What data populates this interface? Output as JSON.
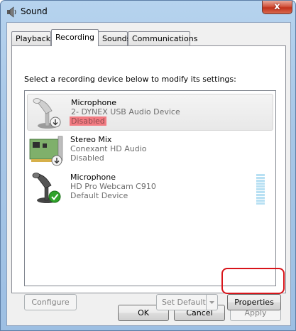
{
  "window": {
    "title": "Sound",
    "close_glyph": "x"
  },
  "tabs": [
    {
      "label": "Playback",
      "active": false
    },
    {
      "label": "Recording",
      "active": true
    },
    {
      "label": "Sounds",
      "active": false
    },
    {
      "label": "Communications",
      "active": false
    }
  ],
  "instruction": "Select a recording device below to modify its settings:",
  "devices": [
    {
      "name": "Microphone",
      "description": "2- DYNEX USB Audio Device",
      "status": "Disabled",
      "icon": "microphone-disabled-icon",
      "selected": true
    },
    {
      "name": "Stereo Mix",
      "description": "Conexant HD Audio",
      "status": "Disabled",
      "icon": "sound-card-disabled-icon",
      "selected": false
    },
    {
      "name": "Microphone",
      "description": "HD Pro Webcam C910",
      "status": "Default Device",
      "icon": "microphone-default-icon",
      "selected": false
    }
  ],
  "buttons": {
    "configure": "Configure",
    "set_default": "Set Default",
    "properties": "Properties",
    "ok": "OK",
    "cancel": "Cancel",
    "apply": "Apply"
  },
  "colors": {
    "highlight": "#f27b82",
    "annotation_ring": "#d8141a",
    "default_check": "#2fa32a"
  }
}
